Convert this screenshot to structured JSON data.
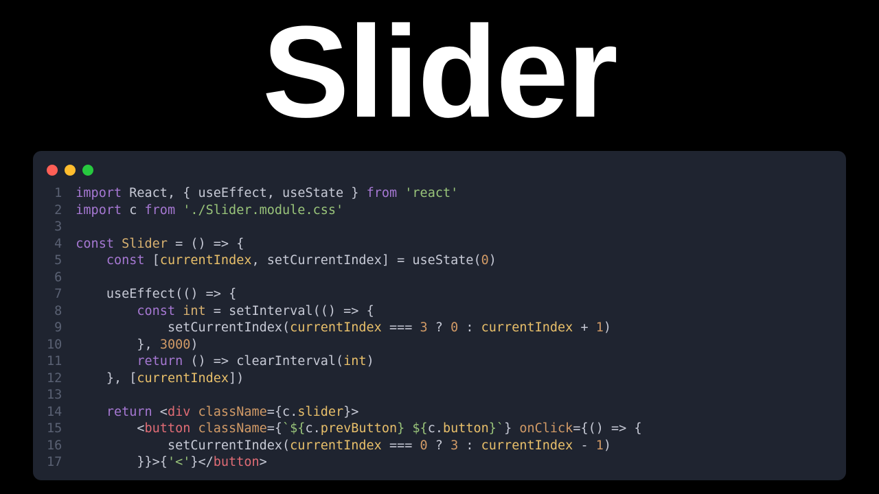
{
  "title": "Slider",
  "window": {
    "buttons": [
      "close",
      "minimize",
      "zoom"
    ]
  },
  "code": {
    "lines": [
      {
        "n": 1,
        "tokens": [
          [
            "kw",
            "import"
          ],
          [
            "",
            " "
          ],
          [
            "fn",
            "React"
          ],
          [
            "punct",
            ", { "
          ],
          [
            "fn",
            "useEffect"
          ],
          [
            "punct",
            ", "
          ],
          [
            "fn",
            "useState"
          ],
          [
            "punct",
            " } "
          ],
          [
            "kw",
            "from"
          ],
          [
            "",
            " "
          ],
          [
            "str",
            "'react'"
          ]
        ]
      },
      {
        "n": 2,
        "tokens": [
          [
            "kw",
            "import"
          ],
          [
            "",
            " "
          ],
          [
            "fn",
            "c"
          ],
          [
            "",
            " "
          ],
          [
            "kw",
            "from"
          ],
          [
            "",
            " "
          ],
          [
            "str",
            "'./Slider.module.css'"
          ]
        ]
      },
      {
        "n": 3,
        "tokens": [
          [
            "",
            ""
          ]
        ]
      },
      {
        "n": 4,
        "tokens": [
          [
            "kw",
            "const"
          ],
          [
            "",
            " "
          ],
          [
            "ident",
            "Slider"
          ],
          [
            "",
            " "
          ],
          [
            "op",
            "="
          ],
          [
            "",
            " () "
          ],
          [
            "op",
            "=>"
          ],
          [
            "",
            " {"
          ]
        ]
      },
      {
        "n": 5,
        "tokens": [
          [
            "",
            "    "
          ],
          [
            "kw",
            "const"
          ],
          [
            "",
            " ["
          ],
          [
            "var",
            "currentIndex"
          ],
          [
            "punct",
            ", "
          ],
          [
            "fn",
            "setCurrentIndex"
          ],
          [
            "punct",
            "] "
          ],
          [
            "op",
            "="
          ],
          [
            "",
            " "
          ],
          [
            "fn",
            "useState"
          ],
          [
            "punct",
            "("
          ],
          [
            "num",
            "0"
          ],
          [
            "punct",
            ")"
          ]
        ]
      },
      {
        "n": 6,
        "tokens": [
          [
            "",
            ""
          ]
        ]
      },
      {
        "n": 7,
        "tokens": [
          [
            "",
            "    "
          ],
          [
            "fn",
            "useEffect"
          ],
          [
            "punct",
            "(() "
          ],
          [
            "op",
            "=>"
          ],
          [
            "",
            " {"
          ]
        ]
      },
      {
        "n": 8,
        "tokens": [
          [
            "",
            "        "
          ],
          [
            "kw",
            "const"
          ],
          [
            "",
            " "
          ],
          [
            "ident",
            "int"
          ],
          [
            "",
            " "
          ],
          [
            "op",
            "="
          ],
          [
            "",
            " "
          ],
          [
            "fn",
            "setInterval"
          ],
          [
            "punct",
            "(() "
          ],
          [
            "op",
            "=>"
          ],
          [
            "",
            " {"
          ]
        ]
      },
      {
        "n": 9,
        "tokens": [
          [
            "",
            "            "
          ],
          [
            "fn",
            "setCurrentIndex"
          ],
          [
            "punct",
            "("
          ],
          [
            "var",
            "currentIndex"
          ],
          [
            "",
            " "
          ],
          [
            "op",
            "==="
          ],
          [
            "",
            " "
          ],
          [
            "num",
            "3"
          ],
          [
            "",
            " "
          ],
          [
            "op",
            "?"
          ],
          [
            "",
            " "
          ],
          [
            "num",
            "0"
          ],
          [
            "",
            " "
          ],
          [
            "op",
            ":"
          ],
          [
            "",
            " "
          ],
          [
            "var",
            "currentIndex"
          ],
          [
            "",
            " "
          ],
          [
            "op",
            "+"
          ],
          [
            "",
            " "
          ],
          [
            "num",
            "1"
          ],
          [
            "punct",
            ")"
          ]
        ]
      },
      {
        "n": 10,
        "tokens": [
          [
            "",
            "        }, "
          ],
          [
            "num",
            "3000"
          ],
          [
            "punct",
            ")"
          ]
        ]
      },
      {
        "n": 11,
        "tokens": [
          [
            "",
            "        "
          ],
          [
            "kw",
            "return"
          ],
          [
            "",
            " () "
          ],
          [
            "op",
            "=>"
          ],
          [
            "",
            " "
          ],
          [
            "fn",
            "clearInterval"
          ],
          [
            "punct",
            "("
          ],
          [
            "var",
            "int"
          ],
          [
            "punct",
            ")"
          ]
        ]
      },
      {
        "n": 12,
        "tokens": [
          [
            "",
            "    }, ["
          ],
          [
            "var",
            "currentIndex"
          ],
          [
            "punct",
            "])"
          ]
        ]
      },
      {
        "n": 13,
        "tokens": [
          [
            "",
            ""
          ]
        ]
      },
      {
        "n": 14,
        "tokens": [
          [
            "",
            "    "
          ],
          [
            "kw",
            "return"
          ],
          [
            "",
            " <"
          ],
          [
            "tag",
            "div"
          ],
          [
            "",
            " "
          ],
          [
            "attr",
            "className"
          ],
          [
            "op",
            "="
          ],
          [
            "punct",
            "{"
          ],
          [
            "fn",
            "c"
          ],
          [
            "punct",
            "."
          ],
          [
            "var",
            "slider"
          ],
          [
            "punct",
            "}>"
          ]
        ]
      },
      {
        "n": 15,
        "tokens": [
          [
            "",
            "        <"
          ],
          [
            "tag",
            "button"
          ],
          [
            "",
            " "
          ],
          [
            "attr",
            "className"
          ],
          [
            "op",
            "="
          ],
          [
            "punct",
            "{"
          ],
          [
            "str",
            "`${"
          ],
          [
            "fn",
            "c"
          ],
          [
            "punct",
            "."
          ],
          [
            "var",
            "prevButton"
          ],
          [
            "str",
            "} ${"
          ],
          [
            "fn",
            "c"
          ],
          [
            "punct",
            "."
          ],
          [
            "var",
            "button"
          ],
          [
            "str",
            "}`"
          ],
          [
            "punct",
            "} "
          ],
          [
            "attr",
            "onClick"
          ],
          [
            "op",
            "="
          ],
          [
            "punct",
            "{() "
          ],
          [
            "op",
            "=>"
          ],
          [
            "",
            " {"
          ]
        ]
      },
      {
        "n": 16,
        "tokens": [
          [
            "",
            "            "
          ],
          [
            "fn",
            "setCurrentIndex"
          ],
          [
            "punct",
            "("
          ],
          [
            "var",
            "currentIndex"
          ],
          [
            "",
            " "
          ],
          [
            "op",
            "==="
          ],
          [
            "",
            " "
          ],
          [
            "num",
            "0"
          ],
          [
            "",
            " "
          ],
          [
            "op",
            "?"
          ],
          [
            "",
            " "
          ],
          [
            "num",
            "3"
          ],
          [
            "",
            " "
          ],
          [
            "op",
            ":"
          ],
          [
            "",
            " "
          ],
          [
            "var",
            "currentIndex"
          ],
          [
            "",
            " "
          ],
          [
            "op",
            "-"
          ],
          [
            "",
            " "
          ],
          [
            "num",
            "1"
          ],
          [
            "punct",
            ")"
          ]
        ]
      },
      {
        "n": 17,
        "tokens": [
          [
            "",
            "        }}>{"
          ],
          [
            "str",
            "'<'"
          ],
          [
            "punct",
            "}</"
          ],
          [
            "tag",
            "button"
          ],
          [
            "punct",
            ">"
          ]
        ]
      }
    ]
  }
}
